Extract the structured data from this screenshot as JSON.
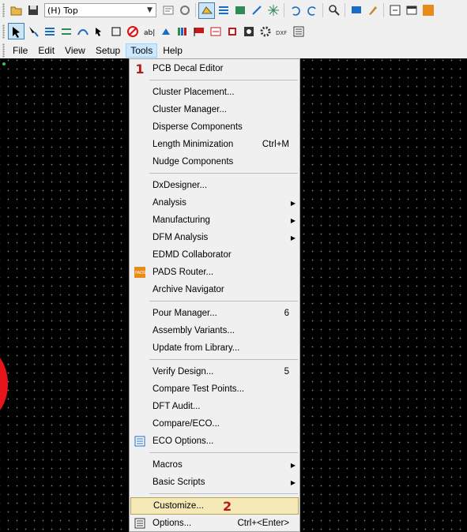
{
  "toolbar1": {
    "layer_select": "(H) Top"
  },
  "menubar": {
    "items": [
      {
        "text": "File"
      },
      {
        "text": "Edit"
      },
      {
        "text": "View"
      },
      {
        "text": "Setup"
      },
      {
        "text": "Tools"
      },
      {
        "text": "Help"
      }
    ]
  },
  "tools_menu": {
    "step1_badge": "1",
    "step2_badge": "2",
    "items": [
      {
        "label": "PCB Decal Editor"
      },
      {
        "label": "Cluster Placement..."
      },
      {
        "label": "Cluster Manager..."
      },
      {
        "label": "Disperse Components"
      },
      {
        "label": "Length Minimization",
        "shortcut": "Ctrl+M"
      },
      {
        "label": "Nudge Components"
      },
      {
        "label": "DxDesigner..."
      },
      {
        "label": "Analysis"
      },
      {
        "label": "Manufacturing"
      },
      {
        "label": "DFM Analysis"
      },
      {
        "label": "EDMD Collaborator"
      },
      {
        "label": "PADS Router..."
      },
      {
        "label": "Archive Navigator"
      },
      {
        "label": "Pour Manager...",
        "shortcut": "6"
      },
      {
        "label": "Assembly Variants..."
      },
      {
        "label": "Update from Library..."
      },
      {
        "label": "Verify Design...",
        "shortcut": "5"
      },
      {
        "label": "Compare Test Points..."
      },
      {
        "label": "DFT Audit..."
      },
      {
        "label": "Compare/ECO..."
      },
      {
        "label": "ECO Options..."
      },
      {
        "label": "Macros"
      },
      {
        "label": "Basic Scripts"
      },
      {
        "label": "Customize..."
      },
      {
        "label": "Options...",
        "shortcut": "Ctrl+<Enter>"
      }
    ]
  },
  "colors": {
    "canvas_bg": "#000000",
    "grid_dot": "#7a7a7a",
    "highlight": "#f5e9b8",
    "badge": "#b11b1b",
    "arc": "#e8141c"
  },
  "icons": [
    "open-icon",
    "save-icon",
    "layer-dropdown",
    "properties-icon",
    "redraw-icon",
    "design-toolbar-icon",
    "route-toolbar-icon",
    "dimension-toolbar-icon",
    "draft-toolbar-icon",
    "eco-toolbar-icon",
    "undo-icon",
    "redo-icon",
    "zoom-icon",
    "select-filter-icon",
    "cleanup-icon",
    "session-icon",
    "window-icon",
    "pads-icon"
  ]
}
